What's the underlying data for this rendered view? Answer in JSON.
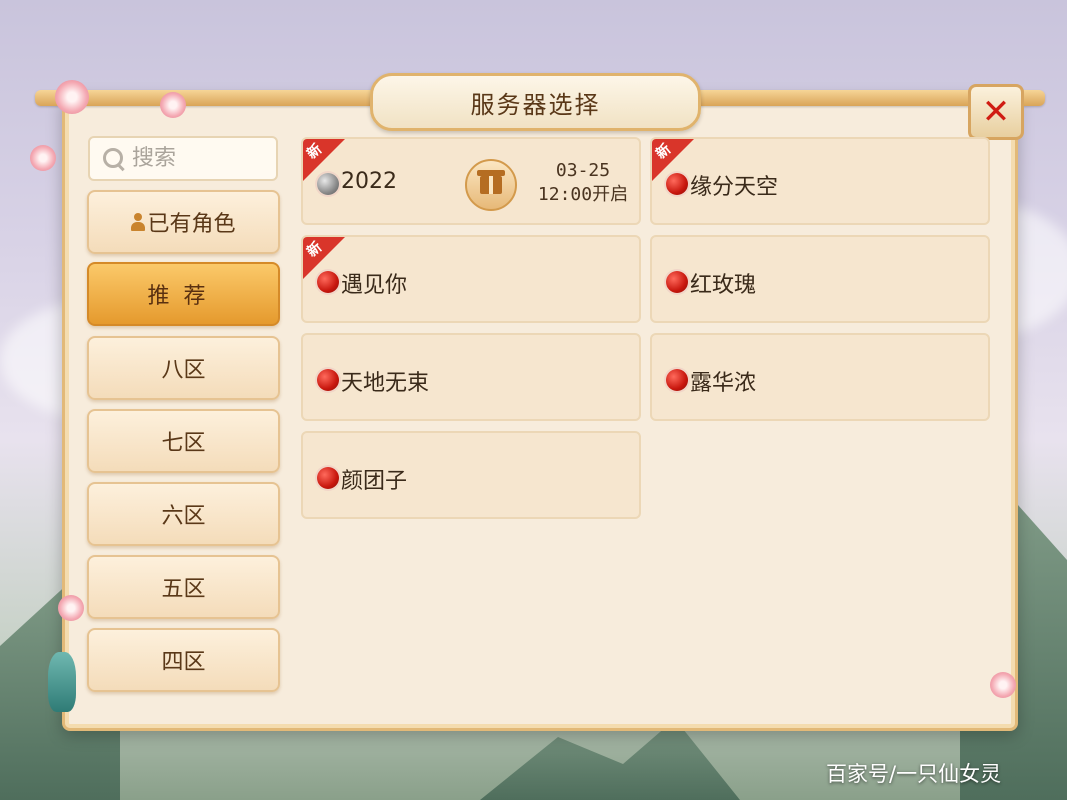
{
  "dialog": {
    "title": "服务器选择",
    "close_label": "✕"
  },
  "search": {
    "placeholder": "搜索"
  },
  "tabs": [
    {
      "label": "已有角色",
      "has_icon": true,
      "active": false
    },
    {
      "label": "推荐",
      "active": true
    },
    {
      "label": "八区",
      "active": false
    },
    {
      "label": "七区",
      "active": false
    },
    {
      "label": "六区",
      "active": false
    },
    {
      "label": "五区",
      "active": false
    },
    {
      "label": "四区",
      "active": false
    }
  ],
  "servers": [
    {
      "name": "2022",
      "status": "gray",
      "is_new": true,
      "gift": true,
      "open_date": "03-25",
      "open_time": "12:00开启"
    },
    {
      "name": "缘分天空",
      "status": "red",
      "is_new": true
    },
    {
      "name": "遇见你",
      "status": "red",
      "is_new": true
    },
    {
      "name": "红玫瑰",
      "status": "red",
      "is_new": false
    },
    {
      "name": "天地无束",
      "status": "red",
      "is_new": false
    },
    {
      "name": "露华浓",
      "status": "red",
      "is_new": false
    },
    {
      "name": "颜团子",
      "status": "red",
      "is_new": false
    }
  ],
  "new_badge": "新",
  "watermark": "百家号/一只仙女灵",
  "colors": {
    "accent": "#e59a2e",
    "status_red": "#c8170e",
    "status_gray": "#8a8a8a",
    "ribbon": "#d9352a"
  }
}
